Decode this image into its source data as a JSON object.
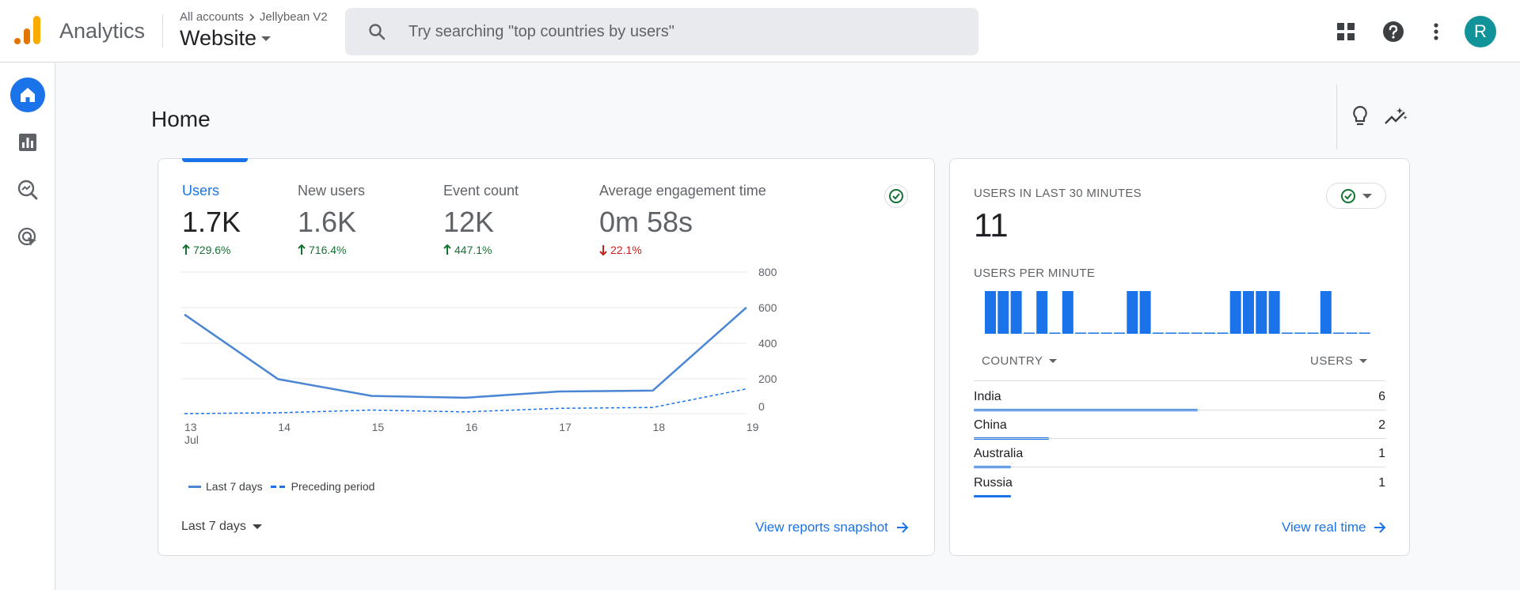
{
  "app": {
    "name": "Analytics"
  },
  "header": {
    "breadcrumb_root": "All accounts",
    "breadcrumb_account": "Jellybean V2",
    "property": "Website",
    "search_placeholder": "Try searching \"top countries by users\"",
    "avatar_initial": "R",
    "avatar_color": "#12939a"
  },
  "page": {
    "title": "Home"
  },
  "metrics": [
    {
      "label": "Users",
      "value": "1.7K",
      "delta": "729.6%",
      "direction": "up"
    },
    {
      "label": "New users",
      "value": "1.6K",
      "delta": "716.4%",
      "direction": "up"
    },
    {
      "label": "Event count",
      "value": "12K",
      "delta": "447.1%",
      "direction": "up"
    },
    {
      "label": "Average engagement time",
      "value": "0m 58s",
      "delta": "22.1%",
      "direction": "down"
    }
  ],
  "chart_data": {
    "type": "line",
    "categories": [
      "13",
      "14",
      "15",
      "16",
      "17",
      "18",
      "19"
    ],
    "x_sublabel": "Jul",
    "y_ticks": [
      800,
      600,
      400,
      200,
      0
    ],
    "ylim": [
      0,
      800
    ],
    "series": [
      {
        "name": "Last 7 days",
        "style": "solid",
        "values": [
          560,
          195,
          100,
          90,
          125,
          130,
          600
        ]
      },
      {
        "name": "Preceding period",
        "style": "dashed",
        "values": [
          0,
          5,
          20,
          10,
          30,
          35,
          140
        ]
      }
    ],
    "grid": true,
    "legend_position": "bottom-left"
  },
  "main_card": {
    "range": "Last 7 days",
    "link": "View reports snapshot"
  },
  "realtime": {
    "title": "USERS IN LAST 30 MINUTES",
    "value": "11",
    "per_minute_label": "USERS PER MINUTE",
    "per_minute": [
      1,
      1,
      1,
      0,
      1,
      0,
      1,
      0,
      0,
      0,
      0,
      1,
      1,
      0,
      0,
      0,
      0,
      0,
      0,
      1,
      1,
      1,
      1,
      0,
      0,
      0,
      1,
      0,
      0,
      0
    ],
    "col_country": "COUNTRY",
    "col_users": "USERS",
    "rows": [
      {
        "country": "India",
        "users": "6",
        "share": 0.545
      },
      {
        "country": "China",
        "users": "2",
        "share": 0.182
      },
      {
        "country": "Australia",
        "users": "1",
        "share": 0.091
      },
      {
        "country": "Russia",
        "users": "1",
        "share": 0.091
      }
    ],
    "link": "View real time"
  },
  "colors": {
    "accent": "#1a73e8",
    "line_current": "#4a86d4",
    "positive": "#137333",
    "negative": "#c5221f",
    "status_ok": "#137333"
  }
}
